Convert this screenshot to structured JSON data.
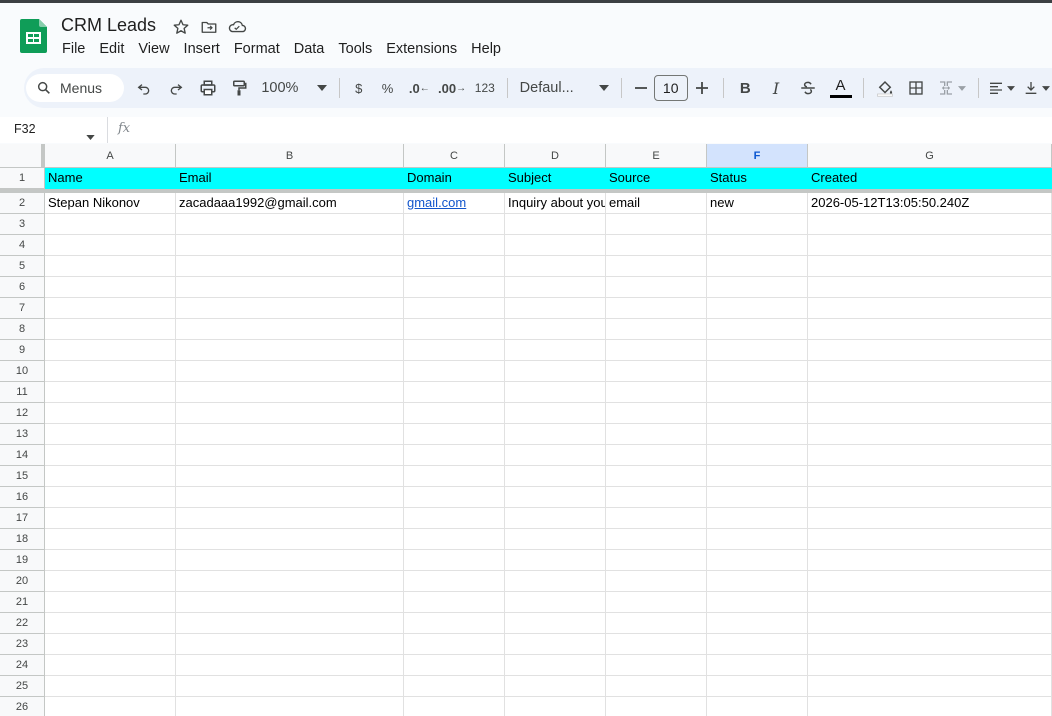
{
  "app": {
    "title": "CRM Leads",
    "menu": [
      "File",
      "Edit",
      "View",
      "Insert",
      "Format",
      "Data",
      "Tools",
      "Extensions",
      "Help"
    ]
  },
  "toolbar": {
    "menus_label": "Menus",
    "zoom": "100%",
    "currency": "$",
    "percent": "%",
    "dec_decrease": ".0",
    "dec_increase": ".00",
    "number_format": "123",
    "font": "Defaul...",
    "font_size": "10",
    "accent_color": "#edf2fa"
  },
  "formula_bar": {
    "cell_ref": "F32",
    "fx": "fx"
  },
  "sheet": {
    "columns": [
      "A",
      "B",
      "C",
      "D",
      "E",
      "F",
      "G"
    ],
    "selected_column": "F",
    "header_row_color": "#00ffff",
    "rows": [
      [
        "Name",
        "Email",
        "Domain",
        "Subject",
        "Source",
        "Status",
        "Created"
      ],
      [
        "Stepan Nikonov",
        "zacadaaa1992@gmail.com",
        "gmail.com",
        "Inquiry about your",
        "email",
        "new",
        "2026-05-12T13:05:50.240Z"
      ]
    ],
    "row_numbers": [
      "1",
      "2",
      "3",
      "4",
      "5",
      "6",
      "7",
      "8",
      "9",
      "10",
      "11",
      "12",
      "13",
      "14",
      "15",
      "16",
      "17",
      "18",
      "19",
      "20",
      "21",
      "22",
      "23",
      "24",
      "25",
      "26"
    ]
  }
}
